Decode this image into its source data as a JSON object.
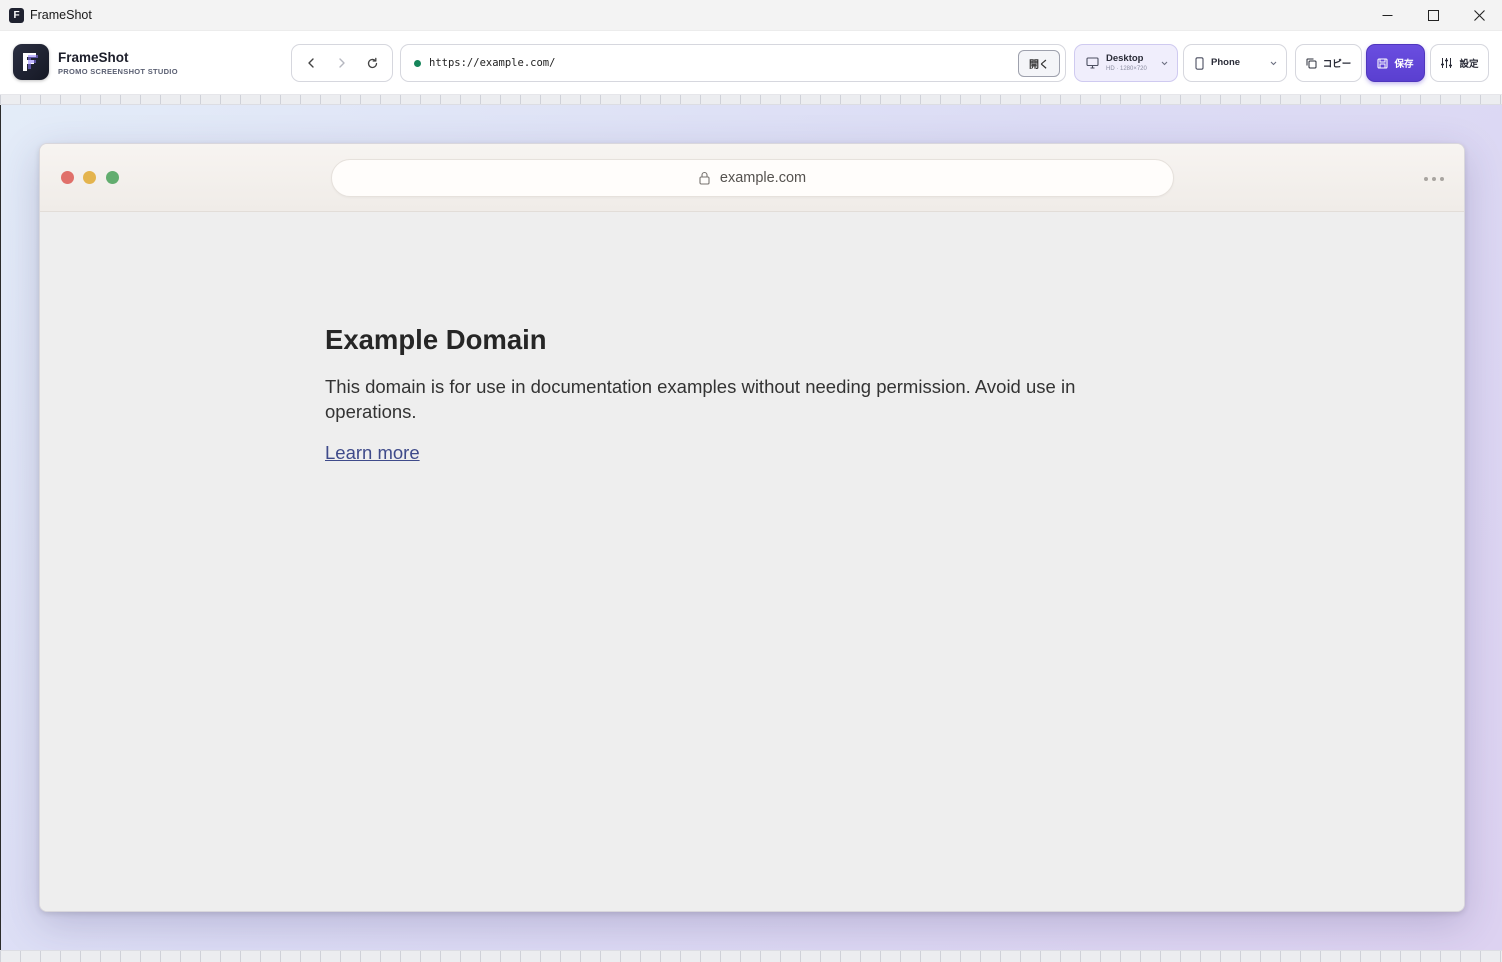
{
  "window": {
    "title": "FrameShot",
    "icon_letter": "F",
    "controls": [
      "minimize-icon",
      "maximize-icon",
      "close-icon"
    ]
  },
  "brand": {
    "name": "FrameShot",
    "subtitle": "PROMO SCREENSHOT STUDIO"
  },
  "address_bar": {
    "url": "https://example.com/",
    "status_color": "#16855a",
    "open_label": "開く"
  },
  "devices": {
    "desktop": {
      "label": "Desktop",
      "resolution": "HD · 1280×720"
    },
    "phone": {
      "label": "Phone"
    }
  },
  "actions": {
    "copy_label": "コピー",
    "save_label": "保存",
    "settings_label": "設定"
  },
  "colors": {
    "accent": "#5a3fd0",
    "canvas_start": "#e3ecf8",
    "canvas_end": "#ddd2f1"
  },
  "preview": {
    "url": "example.com",
    "page": {
      "title": "Example Domain",
      "description": "This domain is for use in documentation examples without needing permission. Avoid use in operations.",
      "link": "Learn more"
    }
  }
}
